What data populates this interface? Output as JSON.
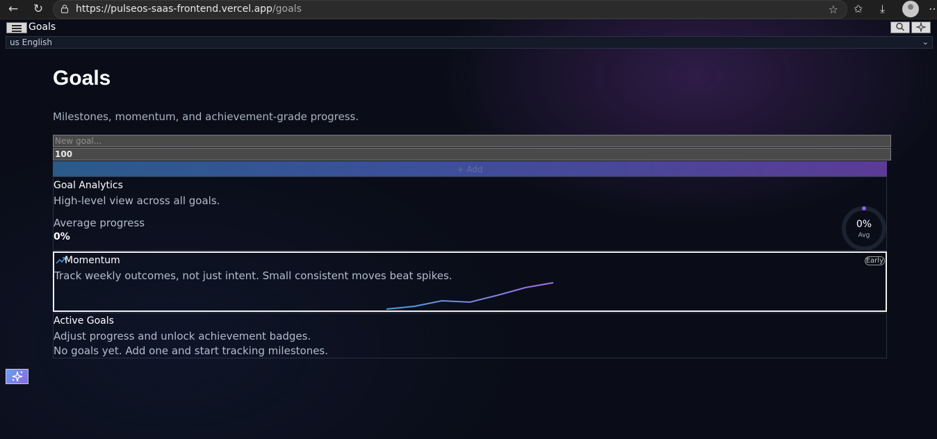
{
  "browser": {
    "url_host": "https://pulseos-saas-frontend.vercel.app",
    "url_path": "/goals"
  },
  "app": {
    "title": "Goals",
    "language": "us English"
  },
  "page": {
    "title": "Goals",
    "subtitle": "Milestones, momentum, and achievement-grade progress."
  },
  "form": {
    "goal_placeholder": "New goal...",
    "target_value": "100",
    "add_label": "+ Add"
  },
  "analytics": {
    "title": "Goal Analytics",
    "description": "High-level view across all goals.",
    "average_label": "Average progress",
    "average_value": "0%",
    "ring_value": "0%",
    "ring_label": "Avg",
    "progress_fraction": 0
  },
  "momentum": {
    "title": "Momentum",
    "description": "Track weekly outcomes, not just intent. Small consistent moves beat spikes.",
    "badge": "Early",
    "line_colors": [
      "#4aa3df",
      "#a46ee8"
    ]
  },
  "active_goals": {
    "title": "Active Goals",
    "description": "Adjust progress and unlock achievement badges.",
    "empty_message": "No goals yet. Add one and start tracking milestones."
  },
  "colors": {
    "background": "#0a0d18",
    "accent_blue": "#4aa3df",
    "accent_purple": "#8b62e6"
  }
}
